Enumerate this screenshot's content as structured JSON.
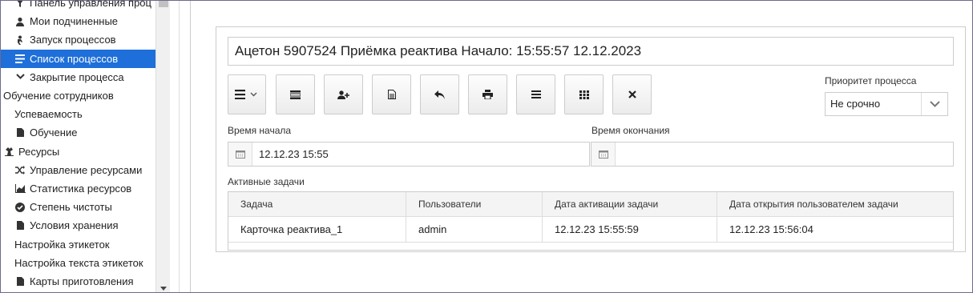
{
  "sidebar": {
    "items": [
      {
        "label": "Панель управления проц",
        "icon": "filter-icon",
        "level": 1,
        "active": false
      },
      {
        "label": "Мои подчиненные",
        "icon": "user-icon",
        "level": 1,
        "active": false
      },
      {
        "label": "Запуск процессов",
        "icon": "user-run-icon",
        "level": 1,
        "active": false
      },
      {
        "label": "Список процессов",
        "icon": "list-icon",
        "level": 1,
        "active": true
      },
      {
        "label": "Закрытие процесса",
        "icon": "chevron-down-icon",
        "level": 1,
        "active": false
      },
      {
        "label": "Обучение сотрудников",
        "icon": "",
        "level": 0,
        "active": false
      },
      {
        "label": "Успеваемость",
        "icon": "",
        "level": 1,
        "active": false
      },
      {
        "label": "Обучение",
        "icon": "document-icon",
        "level": 1,
        "active": false
      },
      {
        "label": "Ресурсы",
        "icon": "resources-icon",
        "level": 0,
        "active": false
      },
      {
        "label": "Управление ресурсами",
        "icon": "shuffle-icon",
        "level": 1,
        "active": false
      },
      {
        "label": "Статистика ресурсов",
        "icon": "area-chart-icon",
        "level": 1,
        "active": false
      },
      {
        "label": "Степень чистоты",
        "icon": "check-circle-icon",
        "level": 1,
        "active": false
      },
      {
        "label": "Условия хранения",
        "icon": "document-icon",
        "level": 1,
        "active": false
      },
      {
        "label": "Настройка этикеток",
        "icon": "",
        "level": 1,
        "active": false
      },
      {
        "label": "Настройка текста этикеток",
        "icon": "",
        "level": 1,
        "active": false
      },
      {
        "label": "Карты приготовления",
        "icon": "document-icon",
        "level": 1,
        "active": false
      }
    ]
  },
  "process": {
    "title": "Ацетон 5907524 Приёмка реактива Начало: 15:55:57 12.12.2023"
  },
  "toolbar": {
    "buttons": [
      {
        "icon": "menu-dropdown-icon"
      },
      {
        "icon": "form-icon"
      },
      {
        "icon": "add-user-icon"
      },
      {
        "icon": "document-icon"
      },
      {
        "icon": "reply-icon"
      },
      {
        "icon": "print-icon"
      },
      {
        "icon": "list-icon"
      },
      {
        "icon": "grid-icon"
      },
      {
        "icon": "close-icon"
      }
    ]
  },
  "priority": {
    "label": "Приоритет процесса",
    "value": "Не срочно"
  },
  "start_time": {
    "label": "Время начала",
    "value": "12.12.23 15:55"
  },
  "end_time": {
    "label": "Время окончания",
    "value": ""
  },
  "active_tasks": {
    "label": "Активные задачи",
    "columns": [
      "Задача",
      "Пользователи",
      "Дата активации задачи",
      "Дата открытия пользователем задачи"
    ],
    "rows": [
      [
        "Карточка реактива_1",
        "admin",
        "12.12.23 15:55:59",
        "12.12.23 15:56:04"
      ]
    ]
  },
  "colors": {
    "accent": "#1e6fd9",
    "border": "#cccccc"
  }
}
